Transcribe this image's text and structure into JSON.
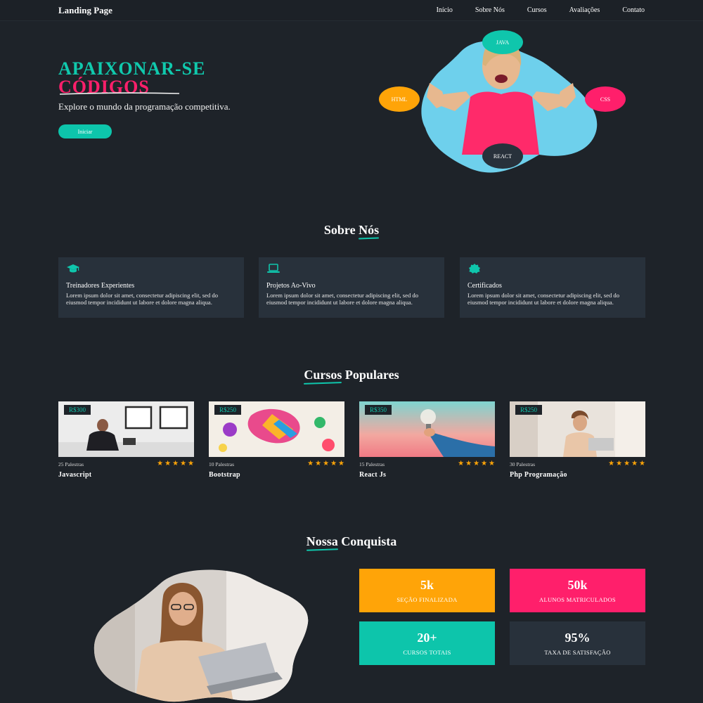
{
  "header": {
    "brand": "Landing Page",
    "nav": [
      "Início",
      "Sobre Nós",
      "Cursos",
      "Avaliações",
      "Contato"
    ]
  },
  "hero": {
    "title_line1": "APAIXONAR-SE",
    "title_line2": "CÓDIGOS",
    "subtitle": "Explore o mundo da programação competitiva.",
    "cta": "Iniciar",
    "bubbles": {
      "java": "JAVA",
      "html": "HTML",
      "css": "CSS",
      "react": "REACT"
    }
  },
  "about": {
    "title_a": "Sobre",
    "title_b": "Nós",
    "cards": [
      {
        "icon": "graduation-cap-icon",
        "title": "Treinadores Experientes",
        "text": "Lorem ipsum dolor sit amet, consectetur adipiscing elit, sed do eiusmod tempor incididunt ut labore et dolore magna aliqua."
      },
      {
        "icon": "laptop-icon",
        "title": "Projetos Ao-Vivo",
        "text": "Lorem ipsum dolor sit amet, consectetur adipiscing elit, sed do eiusmod tempor incididunt ut labore et dolore magna aliqua."
      },
      {
        "icon": "certificate-badge-icon",
        "title": "Certificados",
        "text": "Lorem ipsum dolor sit amet, consectetur adipiscing elit, sed do eiusmod tempor incididunt ut labore et dolore magna aliqua."
      }
    ]
  },
  "courses": {
    "title_a": "Cursos",
    "title_b": "Populares",
    "items": [
      {
        "price": "R$300",
        "lectures": "25 Palestras",
        "rating": 5,
        "name": "Javascript"
      },
      {
        "price": "R$250",
        "lectures": "10 Palestras",
        "rating": 5,
        "name": "Bootstrap"
      },
      {
        "price": "R$350",
        "lectures": "15 Palestras",
        "rating": 5,
        "name": "React Js"
      },
      {
        "price": "R$250",
        "lectures": "30 Palestras",
        "rating": 5,
        "name": "Php Programação"
      }
    ]
  },
  "achievements": {
    "title_a": "Nossa",
    "title_b": "Conquista",
    "stats": [
      {
        "number": "5k",
        "label": "SEÇÃO FINALIZADA",
        "color": "#ffa408"
      },
      {
        "number": "50k",
        "label": "ALUNOS MATRICULADOS",
        "color": "#ff1f6b"
      },
      {
        "number": "20+",
        "label": "CURSOS TOTAIS",
        "color": "#0dc5ab"
      },
      {
        "number": "95%",
        "label": "TAXA DE SATISFAÇÃO",
        "color": "#28313b"
      }
    ]
  },
  "colors": {
    "accent": "#0fc6ac",
    "pink": "#ff1f6b",
    "orange": "#ffa408",
    "bg": "#1e2329",
    "card": "#28313b"
  }
}
